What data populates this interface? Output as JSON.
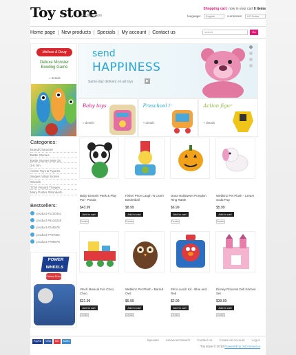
{
  "header": {
    "logo": "Toy store",
    "tagline": "the best store",
    "cart_label": "Shopping cart:",
    "cart_now": "now in your cart",
    "cart_items": "0 items",
    "language_label": "language:",
    "language_value": "English",
    "currencies_label": "currencies:",
    "currency_value": "US Dollar"
  },
  "nav": {
    "items": [
      "Home page",
      "New products",
      "Specials",
      "My account",
      "Contact us"
    ],
    "search_placeholder": "search",
    "go_label": "Go"
  },
  "promo_left": {
    "brand": "Melissa & Doug",
    "title": "Deluxe Monster Bowling Game",
    "details": "» details"
  },
  "hero": {
    "line1": "send",
    "line2": "HAPPINESS",
    "sub": "Same-day delivery on all toys"
  },
  "categories_banner": [
    {
      "name": "Baby toys",
      "details": "» details",
      "color": "#e5187a"
    },
    {
      "name": "Preschool toys",
      "details": "» details",
      "color": "#2aa6d6"
    },
    {
      "name": "Action figures",
      "details": "» details",
      "color": "#8cb83a"
    }
  ],
  "sidebar": {
    "categories_title": "Categories:",
    "categories": [
      "Brand/Character",
      "Battle Stunies",
      "Battle Stunies Mini-3S",
      "3-6 Jim",
      "Action Toys & Figures",
      "Singies Vitaly Stories",
      "Swords",
      "TCM Vinyard Thivges",
      "Mary Poster #Mondesh"
    ],
    "bestsellers_title": "Bestsellers:",
    "bestsellers": [
      "product #1230441",
      "product #6416240",
      "product #246578",
      "product #797002",
      "product #788978"
    ],
    "promo_brand": "POWER WHEELS",
    "promo_sub": "Fisher-Price"
  },
  "products": [
    {
      "name": "Baby Einstein Peek & Play Pal - Panda",
      "price": "$43.99",
      "cart": "Add to cart",
      "details": "Details"
    },
    {
      "name": "Fisher Price Laugh 'N Learn Basketball",
      "price": "$8.99",
      "cart": "Add to cart",
      "details": "Details"
    },
    {
      "name": "Dana Halloween Pumpkin Ring Rattle",
      "price": "$6.99",
      "cart": "Add to cart",
      "details": "Details"
    },
    {
      "name": "Webkinz Pet Plush - Cream Soda Pup",
      "price": "$5.99",
      "cart": "Add to cart",
      "details": "Details"
    },
    {
      "name": "Vtech Musical Fun Choo Choo",
      "price": "$21.99",
      "cart": "Add to cart",
      "details": "Details"
    },
    {
      "name": "Webkinz Pet Plush - Barred Owl",
      "price": "$6.99",
      "cart": "Add to cart",
      "details": "Details"
    },
    {
      "name": "Elmo Lunch Kit - Blue and Red",
      "price": "$2.99",
      "cart": "Add to cart",
      "details": "Details"
    },
    {
      "name": "Disney Princess Doll Kitchen Set",
      "price": "$39.99",
      "cart": "Add to cart",
      "details": "Details"
    }
  ],
  "footer": {
    "payments": [
      "PayPal",
      "VISA",
      "MC",
      "AMEX"
    ],
    "links": [
      "Specials",
      "Advanced Search",
      "Contact Us",
      "Create an Account",
      "Log In"
    ],
    "copy_prefix": "Toy store © 2010",
    "copy_link": "Powered by osCommerce"
  }
}
